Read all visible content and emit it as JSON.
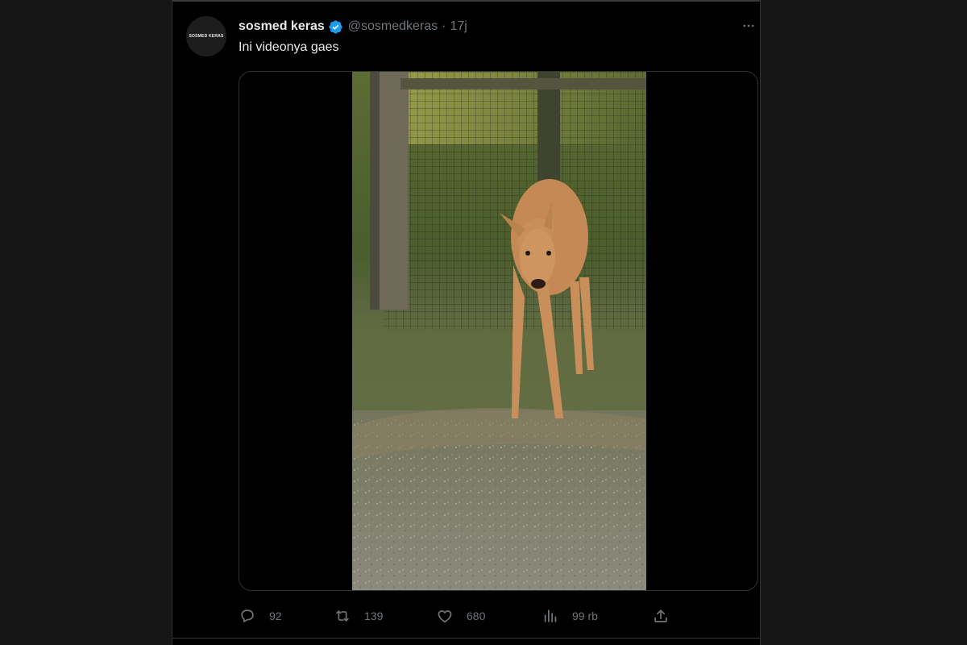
{
  "tweet": {
    "avatar_text": "SOSMED KERAS",
    "display_name": "sosmed keras",
    "handle": "@sosmedkeras",
    "separator": "·",
    "time": "17j",
    "text": "Ini videonya gaes"
  },
  "actions": {
    "reply_count": "92",
    "retweet_count": "139",
    "like_count": "680",
    "views_count": "99 rb"
  },
  "colors": {
    "background": "#000000",
    "text": "#e7e9ea",
    "muted": "#71767b",
    "border": "#2f3336",
    "verified": "#1d9bf0"
  },
  "icons": [
    "verified-badge-icon",
    "more-icon",
    "reply-icon",
    "retweet-icon",
    "like-icon",
    "views-icon",
    "share-icon"
  ]
}
